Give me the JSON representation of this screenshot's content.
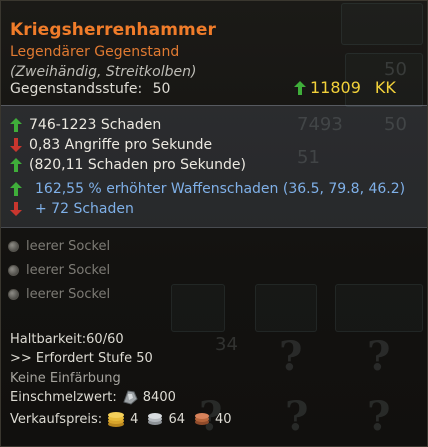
{
  "item": {
    "name": "Kriegsherrenhammer",
    "rarity": "Legendärer Gegenstand",
    "subtype": "(Zweihändig, Streitkolben)",
    "level_label": "Gegenstandsstufe:",
    "level_value": "50",
    "score": "11809",
    "score_unit": "KK",
    "score_color": "#f2d13a",
    "name_color": "#f07c2a"
  },
  "stats": [
    {
      "text": "746-1223 Schaden",
      "direction": "up"
    },
    {
      "text": "0,83 Angriffe pro Sekunde",
      "direction": "down"
    },
    {
      "text": "(820,11 Schaden pro Sekunde)",
      "direction": "up"
    },
    {
      "text": "162,55 % erhöhter Waffenschaden (36.5, 79.8, 46.2)",
      "direction": "up",
      "style": "blue"
    },
    {
      "text": "+ 72 Schaden",
      "direction": "down",
      "style": "blue"
    }
  ],
  "sockets": [
    {
      "label": "leerer Sockel"
    },
    {
      "label": "leerer Sockel"
    },
    {
      "label": "leerer Sockel"
    }
  ],
  "footer": {
    "durability": "Haltbarkeit:60/60",
    "requirement": ">> Erfordert Stufe 50",
    "dye": "Keine Einfärbung",
    "smelt_label": "Einschmelzwert:",
    "smelt_value": "8400",
    "sell_label": "Verkaufspreis:",
    "sell_gold": "4",
    "sell_silver": "64",
    "sell_copper": "40"
  },
  "background_numbers": [
    "50",
    "7493",
    "50",
    "51",
    "34"
  ],
  "icons": {
    "up_arrow": "green-up-arrow-icon",
    "down_arrow": "red-down-arrow-icon",
    "socket": "empty-socket-icon",
    "smelt": "silver-ore-icon",
    "gold": "gold-coin-icon",
    "silver": "silver-coin-icon",
    "copper": "copper-coin-icon"
  },
  "colors": {
    "up": "#3fae3a",
    "down": "#c8362e",
    "blue_stat": "#7fb0e8"
  }
}
